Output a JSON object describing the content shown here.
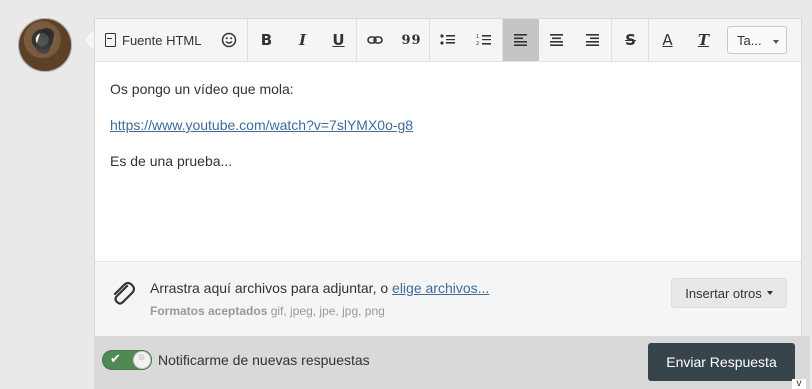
{
  "toolbar": {
    "source_label": "Fuente HTML",
    "styles_label": "Ta...",
    "icons": [
      "smile-icon",
      "bold-icon",
      "italic-icon",
      "underline-icon",
      "link-icon",
      "quote-icon",
      "bullet-list-icon",
      "numbered-list-icon",
      "align-left-icon",
      "align-center-icon",
      "align-right-icon",
      "strikethrough-icon",
      "text-color-icon",
      "clear-format-icon"
    ],
    "bold_glyph": "B",
    "italic_glyph": "I",
    "underline_glyph": "U",
    "quote_glyph": "99",
    "strike_glyph": "S",
    "text_color_glyph": "A",
    "clear_format_glyph": "T"
  },
  "content": {
    "line1": "Os pongo un vídeo que mola:",
    "link": "https://www.youtube.com/watch?v=7slYMX0o-g8",
    "line3": "Es de una prueba..."
  },
  "attach": {
    "text": "Arrastra aquí archivos para adjuntar, o",
    "choose_link": "elige archivos...",
    "formats_label": "Formatos aceptados",
    "formats": "gif, jpeg, jpe, jpg, png",
    "insert_button": "Insertar otros"
  },
  "footer": {
    "notify_label": "Notificarme de nuevas respuestas",
    "notify_on": true,
    "send_button": "Enviar Respuesta",
    "corner_glyph": "v"
  },
  "colors": {
    "toggle_on": "#4f8a55",
    "send_button": "#38444b",
    "link": "#3e6b9a"
  }
}
